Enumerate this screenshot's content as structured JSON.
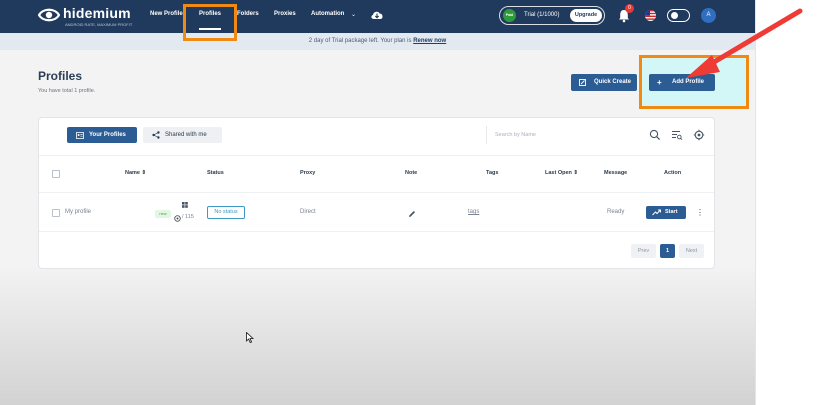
{
  "brand": {
    "name": "hidemium",
    "tagline": "ANDROID RATE, MAXIMUM PROFIT",
    "logo_icon": "eye-logo-icon"
  },
  "nav": {
    "items": [
      {
        "label": "New Profile"
      },
      {
        "label": "Profiles"
      },
      {
        "label": "Folders"
      },
      {
        "label": "Proxies"
      },
      {
        "label": "Automation"
      }
    ],
    "active": "Profiles",
    "automation_chevron": "⌄",
    "cloud_icon": "cloud-download-icon"
  },
  "account": {
    "plan_badge": "Paid",
    "trial_text": "Trial (1/1000)",
    "upgrade_label": "Upgrade",
    "notification_count": "0",
    "language_flag": "us-flag-icon",
    "avatar_letter": "A"
  },
  "banner": {
    "text": "2 day of Trial package left. Your plan is ",
    "link": "Renew now"
  },
  "page": {
    "title": "Profiles",
    "subtitle": "You have total 1 profile.",
    "quick_create_label": "Quick Create",
    "add_profile_label": "Add Profile",
    "add_icon": "+"
  },
  "tabs": {
    "yours_label": "Your Profiles",
    "shared_label": "Shared with me"
  },
  "search": {
    "placeholder": "Search by Name",
    "value": ""
  },
  "table": {
    "headers": {
      "name": "Name ⇕",
      "status": "Status",
      "proxy": "Proxy",
      "note": "Note",
      "tags": "Tags",
      "last_open": "Last Open ⇕",
      "message": "Message",
      "action": "Action"
    },
    "rows": [
      {
        "name": "My profile",
        "new_tag": "new",
        "browser_meta": "/ 115",
        "status": "No status",
        "proxy": "Direct",
        "tags": "tags",
        "message": "Ready",
        "action_label": "Start"
      }
    ]
  },
  "pagination": {
    "prev": "Prev",
    "current": "1",
    "next": "Next"
  },
  "colors": {
    "navbar": "#1f3a5c",
    "primary": "#2b5c93",
    "annotation_orange": "#f18a12",
    "annotation_red": "#ee3b36",
    "highlight_fill": "#d0f7f7"
  }
}
